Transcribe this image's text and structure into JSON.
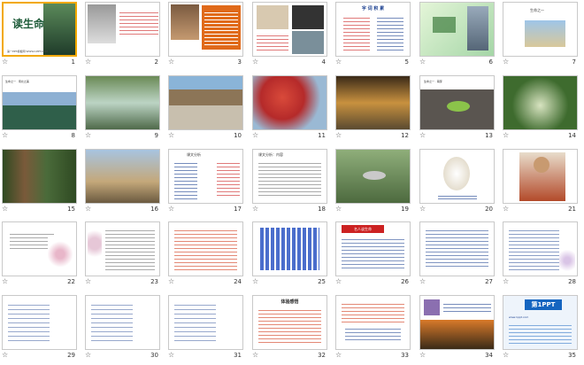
{
  "app": {
    "title": "读生命"
  },
  "slides": [
    {
      "num": "1",
      "title": "读生命",
      "subtitle": "第一PPT模板网 WWW.1PPT.COM",
      "theme": "cover"
    },
    {
      "num": "2",
      "text": "作者杏林子：原名刘侠……",
      "theme": "photo-text"
    },
    {
      "num": "3",
      "text": "课文“向生命发问”……",
      "theme": "photo-text-orange"
    },
    {
      "num": "4",
      "theme": "photos"
    },
    {
      "num": "5",
      "title": "字 词 积 累",
      "theme": "words"
    },
    {
      "num": "6",
      "theme": "green-city"
    },
    {
      "num": "7",
      "text": "生命之一",
      "theme": "landscape-sky"
    },
    {
      "num": "8",
      "text": "生命之一 · 南北之美",
      "theme": "mountain"
    },
    {
      "num": "9",
      "theme": "waterfall"
    },
    {
      "num": "10",
      "theme": "river"
    },
    {
      "num": "11",
      "theme": "blossom"
    },
    {
      "num": "12",
      "theme": "sunset-river"
    },
    {
      "num": "13",
      "text": "生命之一 · 萌芽",
      "theme": "leaf"
    },
    {
      "num": "14",
      "theme": "forest"
    },
    {
      "num": "15",
      "theme": "tree-bark"
    },
    {
      "num": "16",
      "theme": "bare-trees"
    },
    {
      "num": "17",
      "title": "课文分析",
      "theme": "analysis"
    },
    {
      "num": "18",
      "title": "课文分析：内容",
      "theme": "text-bullets"
    },
    {
      "num": "19",
      "theme": "fish"
    },
    {
      "num": "20",
      "theme": "egg"
    },
    {
      "num": "21",
      "theme": "person"
    },
    {
      "num": "22",
      "text": "导读：“生命可以很长……”",
      "theme": "flowers"
    },
    {
      "num": "23",
      "theme": "flowers-text"
    },
    {
      "num": "24",
      "theme": "text-red"
    },
    {
      "num": "25",
      "theme": "text-blue-dense"
    },
    {
      "num": "26",
      "title": "名人谈生命",
      "theme": "quotes"
    },
    {
      "num": "27",
      "theme": "text-block"
    },
    {
      "num": "28",
      "theme": "text-flowers"
    },
    {
      "num": "29",
      "theme": "text-small"
    },
    {
      "num": "30",
      "theme": "text-small"
    },
    {
      "num": "31",
      "theme": "text-small"
    },
    {
      "num": "32",
      "title": "体验感悟",
      "theme": "text-red-title"
    },
    {
      "num": "33",
      "theme": "text-red-blue"
    },
    {
      "num": "34",
      "text": "课外拓展",
      "theme": "sunset"
    },
    {
      "num": "35",
      "title": "第1PPT",
      "text": "www.1ppt.com",
      "theme": "brand"
    }
  ],
  "colors": {
    "accent": "#f2a900",
    "link": "#1a3f8f",
    "border": "#c9c9c9"
  }
}
